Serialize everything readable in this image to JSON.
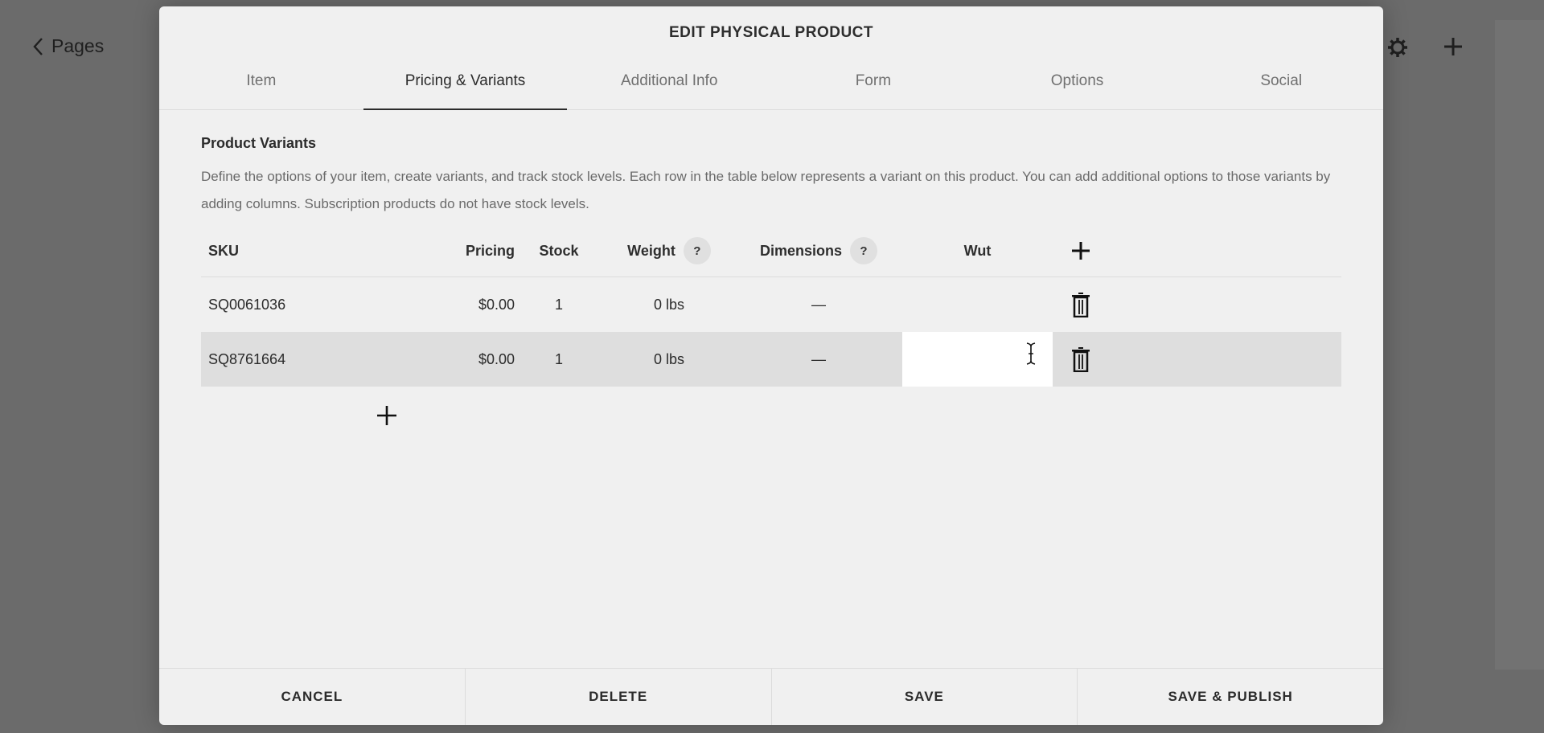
{
  "background": {
    "back_label": "Pages",
    "icons": [
      "chevron-left-icon",
      "gear-icon",
      "plus-icon"
    ]
  },
  "modal": {
    "title": "EDIT PHYSICAL PRODUCT",
    "tabs": [
      {
        "label": "Item",
        "active": false
      },
      {
        "label": "Pricing & Variants",
        "active": true
      },
      {
        "label": "Additional Info",
        "active": false
      },
      {
        "label": "Form",
        "active": false
      },
      {
        "label": "Options",
        "active": false
      },
      {
        "label": "Social",
        "active": false
      }
    ],
    "section": {
      "title": "Product Variants",
      "description": "Define the options of your item, create variants, and track stock levels. Each row in the table below represents a variant on this product. You can add additional options to those variants by adding columns. Subscription products do not have stock levels."
    },
    "table": {
      "columns": {
        "sku": "SKU",
        "pricing": "Pricing",
        "stock": "Stock",
        "weight": "Weight",
        "dimensions": "Dimensions",
        "custom": "Wut",
        "help": "?"
      },
      "rows": [
        {
          "sku": "SQ0061036",
          "pricing": "$0.00",
          "stock": "1",
          "weight": "0 lbs",
          "dimensions": "—",
          "custom": ""
        },
        {
          "sku": "SQ8761664",
          "pricing": "$0.00",
          "stock": "1",
          "weight": "0 lbs",
          "dimensions": "—",
          "custom": ""
        }
      ]
    },
    "footer": {
      "cancel": "CANCEL",
      "delete": "DELETE",
      "save": "SAVE",
      "save_publish": "SAVE & PUBLISH"
    }
  }
}
